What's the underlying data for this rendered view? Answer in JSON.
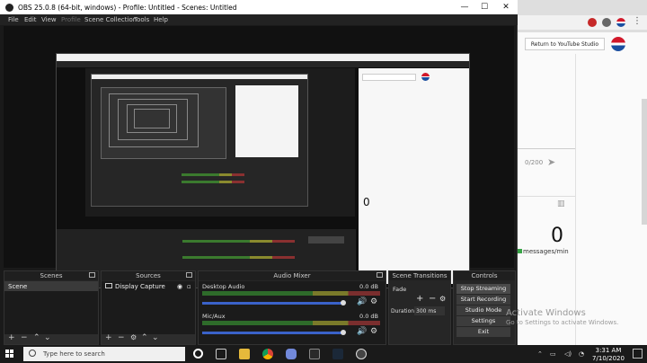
{
  "window": {
    "title": "OBS 25.0.8 (64-bit, windows) - Profile: Untitled - Scenes: Untitled",
    "minimize": "—",
    "maximize": "☐",
    "close": "✕"
  },
  "menu": [
    "File",
    "Edit",
    "View",
    "Profile",
    "Scene Collection",
    "Tools",
    "Help"
  ],
  "docks": {
    "scenes": {
      "title": "Scenes",
      "items": [
        "Scene"
      ]
    },
    "sources": {
      "title": "Sources",
      "items": [
        "Display Capture"
      ]
    },
    "mixer": {
      "title": "Audio Mixer",
      "channels": [
        {
          "name": "Desktop Audio",
          "db": "0.0 dB",
          "level": 0.62
        },
        {
          "name": "Mic/Aux",
          "db": "0.0 dB",
          "level": 0.62
        }
      ]
    },
    "transitions": {
      "title": "Scene Transitions",
      "type": "Fade",
      "duration_label": "Duration",
      "duration": "300 ms"
    },
    "controls": {
      "title": "Controls",
      "buttons": [
        "Stop Streaming",
        "Start Recording",
        "Studio Mode",
        "Settings",
        "Exit"
      ]
    }
  },
  "youtube": {
    "return_label": "Return to YouTube Studio",
    "char_count": "0/200",
    "viewers": "0",
    "messages_label": "messages/min"
  },
  "watermark": {
    "line1": "Activate Windows",
    "line2": "Go to Settings to activate Windows."
  },
  "taskbar": {
    "search_placeholder": "Type here to search",
    "time": "3:31 AM",
    "date": "7/10/2020"
  },
  "colors": {
    "accent": "#3a62c9",
    "meter_green": "#2e6b2a",
    "pepsi_red": "#d2182a",
    "pepsi_blue": "#1b4fa0"
  }
}
